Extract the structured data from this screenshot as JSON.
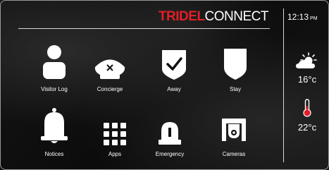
{
  "brand": {
    "accent": "TRIDEL",
    "rest": "CONNECT",
    "accent_color": "#e21f26"
  },
  "tiles": [
    {
      "label": "Visitor Log",
      "icon": "person-icon"
    },
    {
      "label": "Concierge",
      "icon": "concierge-hat-icon"
    },
    {
      "label": "Away",
      "icon": "shield-check-icon"
    },
    {
      "label": "Stay",
      "icon": "shield-icon"
    },
    {
      "label": "Notices",
      "icon": "bell-icon"
    },
    {
      "label": "Apps",
      "icon": "grid-icon"
    },
    {
      "label": "Emergency",
      "icon": "siren-icon"
    },
    {
      "label": "Cameras",
      "icon": "security-camera-icon"
    }
  ],
  "status": {
    "time": "12:13",
    "ampm": "PM",
    "outdoor_temp": "16°c",
    "outdoor_icon": "partly-cloudy-icon",
    "indoor_temp": "22°c",
    "indoor_icon": "thermometer-icon"
  }
}
